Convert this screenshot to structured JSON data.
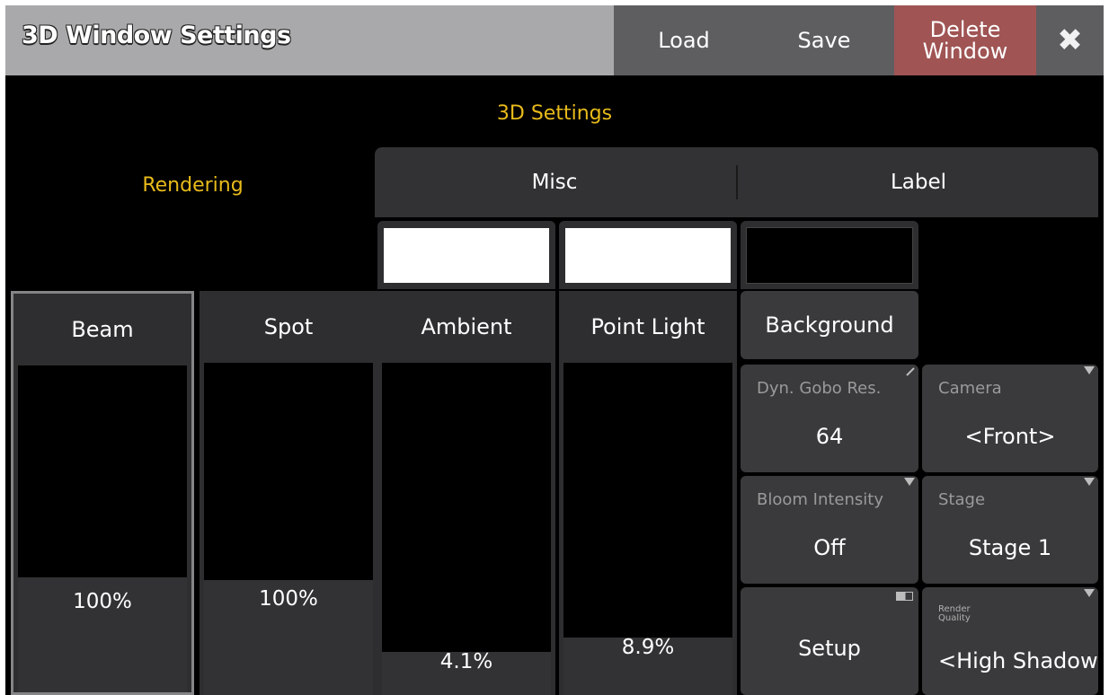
{
  "window": {
    "title": "3D Window Settings",
    "buttons": {
      "load": "Load",
      "save": "Save",
      "delete_line1": "Delete",
      "delete_line2": "Window",
      "close": "✖"
    }
  },
  "heading": "3D Settings",
  "tabs": {
    "rendering": "Rendering",
    "misc": "Misc",
    "label": "Label"
  },
  "faders": [
    {
      "label": "Beam",
      "value": "100%"
    },
    {
      "label": "Spot",
      "value": "100%"
    },
    {
      "label": "Ambient",
      "value": "4.1%"
    },
    {
      "label": "Point Light",
      "value": "8.9%"
    }
  ],
  "swatches": {
    "ambient_color": "#ffffff",
    "point_light_color": "#ffffff",
    "background_color": "#000000"
  },
  "background_button": "Background",
  "settings": {
    "dyn_gobo_res": {
      "label": "Dyn. Gobo Res.",
      "value": "64"
    },
    "camera": {
      "label": "Camera",
      "value": "<Front>"
    },
    "bloom_intensity": {
      "label": "Bloom Intensity",
      "value": "Off"
    },
    "stage": {
      "label": "Stage",
      "value": "Stage 1"
    },
    "setup": {
      "label": "Setup"
    },
    "render_quality": {
      "label_line1": "Render",
      "label_line2": "Quality",
      "value": "<High Shadow"
    }
  },
  "colors": {
    "accent": "#e8bb1a",
    "delete": "#a05454",
    "panel": "#2e2e30"
  }
}
